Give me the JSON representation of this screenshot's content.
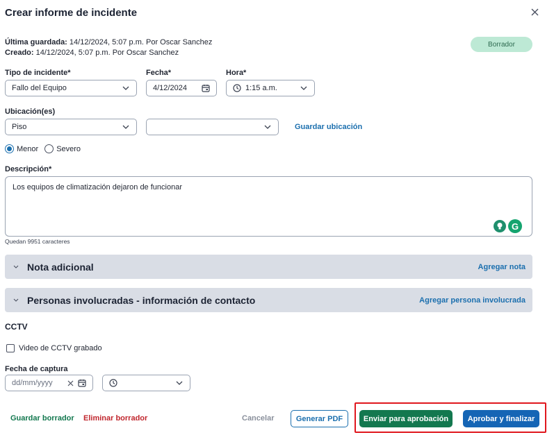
{
  "dialog": {
    "title": "Crear informe de incidente",
    "status_badge": "Borrador"
  },
  "meta": {
    "saved_label": "Última guardada:",
    "saved_value": "14/12/2024, 5:07 p.m. Por Oscar Sanchez",
    "created_label": "Creado:",
    "created_value": "14/12/2024, 5:07 p.m. Por Oscar Sanchez"
  },
  "form": {
    "incident_type": {
      "label": "Tipo de incidente*",
      "value": "Fallo del Equipo"
    },
    "date": {
      "label": "Fecha*",
      "value": "4/12/2024"
    },
    "time": {
      "label": "Hora*",
      "value": "1:15 a.m."
    },
    "location": {
      "label": "Ubicación(es)",
      "primary_value": "Piso",
      "secondary_value": "",
      "save_link": "Guardar ubicación"
    },
    "severity": {
      "options": [
        "Menor",
        "Severo"
      ],
      "selected": "Menor"
    },
    "description": {
      "label": "Descripción*",
      "value": "Los equipos de climatización dejaron de funcionar",
      "remaining": "Quedan 9951 caracteres"
    }
  },
  "accordions": [
    {
      "title": "Nota adicional",
      "action": "Agregar nota"
    },
    {
      "title": "Personas involucradas - información de contacto",
      "action": "Agregar persona involucrada"
    }
  ],
  "cctv": {
    "section_title": "CCTV",
    "recorded_label": "Video de CCTV grabado",
    "capture_date_label": "Fecha de captura",
    "capture_date_placeholder": "dd/mm/yyyy",
    "capture_time_value": ""
  },
  "footer": {
    "save_draft": "Guardar borrador",
    "delete_draft": "Eliminar borrador",
    "cancel": "Cancelar",
    "generate_pdf": "Generar PDF",
    "send_for_approval": "Enviar para aprobación",
    "approve_finalize": "Aprobar y finalizar"
  },
  "colors": {
    "accent_blue": "#1b6fae",
    "green_button": "#13784f",
    "blue_button": "#1565b5",
    "badge_bg": "#bde9d5",
    "delete_red": "#c0262d",
    "highlight_red": "#e0161d"
  }
}
